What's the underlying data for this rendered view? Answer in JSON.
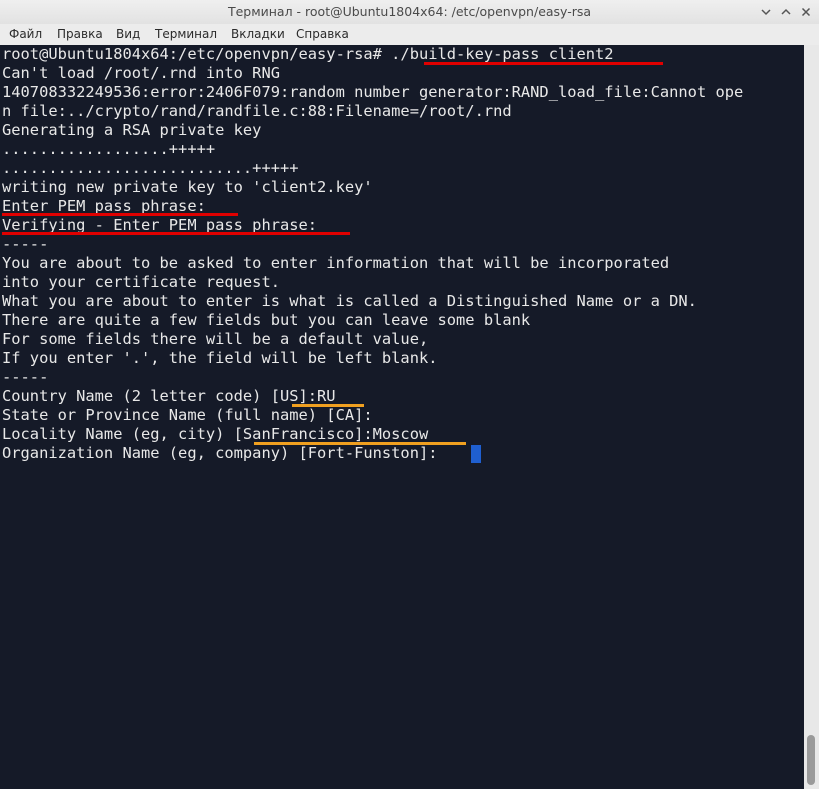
{
  "window": {
    "title": "Терминал - root@Ubuntu1804x64: /etc/openvpn/easy-rsa",
    "buttons": {
      "minimize_icon": "minimize-icon",
      "maximize_icon": "maximize-icon",
      "close_icon": "close-icon"
    }
  },
  "menu": {
    "items": [
      "Файл",
      "Правка",
      "Вид",
      "Терминал",
      "Вкладки",
      "Справка"
    ]
  },
  "terminal": {
    "background": "#151a28",
    "foreground": "#e8e8e8",
    "lines": [
      "root@Ubuntu1804x64:/etc/openvpn/easy-rsa# ./build-key-pass client2",
      "Can't load /root/.rnd into RNG",
      "140708332249536:error:2406F079:random number generator:RAND_load_file:Cannot ope",
      "n file:../crypto/rand/randfile.c:88:Filename=/root/.rnd",
      "Generating a RSA private key",
      "..................+++++",
      "...........................+++++",
      "writing new private key to 'client2.key'",
      "Enter PEM pass phrase:",
      "Verifying - Enter PEM pass phrase:",
      "-----",
      "You are about to be asked to enter information that will be incorporated",
      "into your certificate request.",
      "What you are about to enter is what is called a Distinguished Name or a DN.",
      "There are quite a few fields but you can leave some blank",
      "For some fields there will be a default value,",
      "If you enter '.', the field will be left blank.",
      "-----",
      "Country Name (2 letter code) [US]:RU",
      "State or Province Name (full name) [CA]:",
      "Locality Name (eg, city) [SanFrancisco]:Moscow",
      "Organization Name (eg, company) [Fort-Funston]:"
    ],
    "highlight_colors": {
      "red": "#e00000",
      "orange": "#f0a020"
    },
    "cursor_color": "#1f5fd0"
  }
}
